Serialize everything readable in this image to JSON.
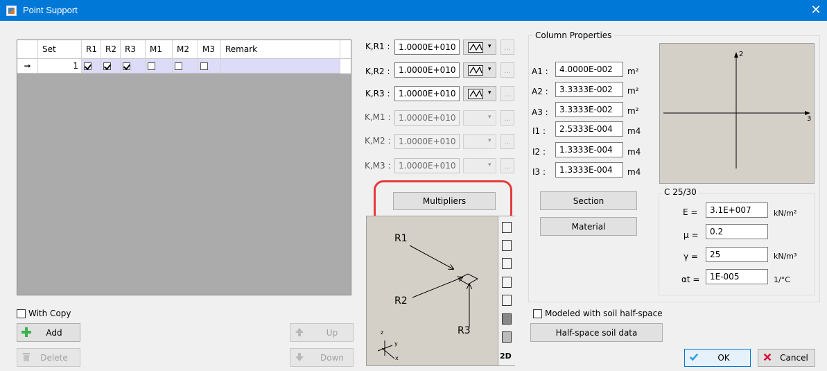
{
  "window": {
    "title": "Point Support",
    "close": "✕"
  },
  "grid": {
    "columns": [
      "Set",
      "R1",
      "R2",
      "R3",
      "M1",
      "M2",
      "M3",
      "Remark"
    ],
    "row": {
      "indicator": "➞",
      "set": "1",
      "checks": [
        true,
        true,
        true,
        false,
        false,
        false
      ],
      "remark": ""
    }
  },
  "left": {
    "with_copy": "With Copy",
    "add": "Add",
    "delete": "Delete",
    "up": "Up",
    "down": "Down"
  },
  "springs": [
    {
      "label": "K,R1 :",
      "value": "1.0000E+010",
      "enabled": true
    },
    {
      "label": "K,R2 :",
      "value": "1.0000E+010",
      "enabled": true
    },
    {
      "label": "K,R3 :",
      "value": "1.0000E+010",
      "enabled": true
    },
    {
      "label": "K,M1 :",
      "value": "1.0000E+010",
      "enabled": false
    },
    {
      "label": "K,M2 :",
      "value": "1.0000E+010",
      "enabled": false
    },
    {
      "label": "K,M3 :",
      "value": "1.0000E+010",
      "enabled": false
    }
  ],
  "ellipsis": "...",
  "multipliers": "Multipliers",
  "preview": {
    "r1": "R1",
    "r2": "R2",
    "r3": "R3",
    "mode_2d": "2D",
    "axis_z": "z",
    "axis_y": "y",
    "axis_x": "x"
  },
  "column": {
    "legend": "Column Properties",
    "rows": [
      {
        "label": "A1 :",
        "value": "4.0000E-002",
        "unit": "m²"
      },
      {
        "label": "A2 :",
        "value": "3.3333E-002",
        "unit": "m²"
      },
      {
        "label": "A3 :",
        "value": "3.3333E-002",
        "unit": "m²"
      },
      {
        "label": "I1 :",
        "value": "2.5333E-004",
        "unit": "m4"
      },
      {
        "label": "I2 :",
        "value": "1.3333E-004",
        "unit": "m4"
      },
      {
        "label": "I3 :",
        "value": "1.3333E-004",
        "unit": "m4"
      }
    ],
    "section": "Section",
    "material": "Material",
    "axis2": "2",
    "axis3": "3"
  },
  "material": {
    "legend": "C 25/30",
    "rows": [
      {
        "label": "E =",
        "value": "3.1E+007",
        "unit": "kN/m²"
      },
      {
        "label": "μ =",
        "value": "0.2",
        "unit": ""
      },
      {
        "label": "γ =",
        "value": "25",
        "unit": "kN/m³"
      },
      {
        "label": "αt =",
        "value": "1E-005",
        "unit": "1/°C"
      }
    ]
  },
  "soil": {
    "checkbox": "Modeled with soil half-space",
    "button": "Half-space soil data"
  },
  "footer": {
    "ok": "OK",
    "cancel": "Cancel"
  },
  "colors": {
    "titlebar": "#0078d7",
    "highlight": "#e53a3a",
    "ok_check": "#2f9fe0",
    "cancel_x": "#d4143c",
    "add_plus": "#38b34a"
  }
}
